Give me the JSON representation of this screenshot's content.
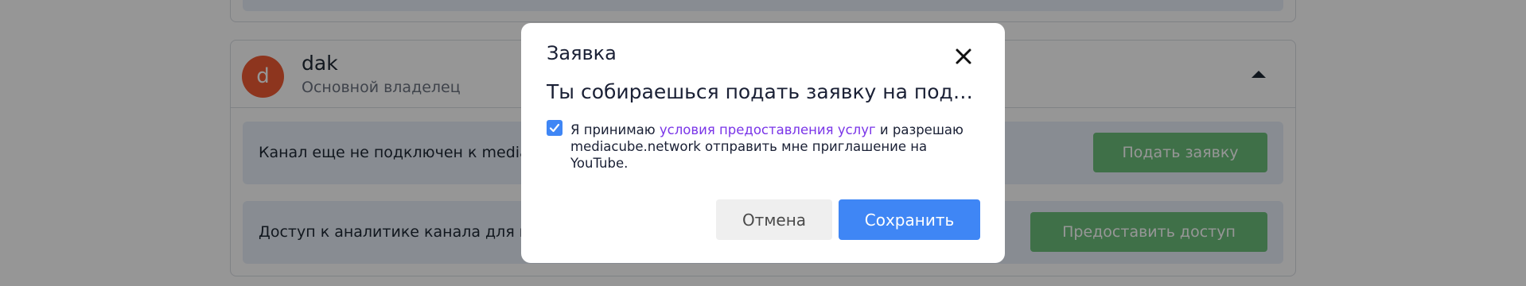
{
  "background": {
    "owner": {
      "avatar_letter": "d",
      "name": "dak",
      "role": "Основной владелец"
    },
    "rows": [
      {
        "text": "Канал еще не подключен к mediacube.network",
        "button": "Подать заявку"
      },
      {
        "text": "Доступ к аналитике канала для mediacube.network",
        "button": "Предоставить доступ"
      }
    ]
  },
  "modal": {
    "title": "Заявка",
    "subtitle": "Ты собираешься подать заявку на подключение канала",
    "consent": {
      "checked": true,
      "text_before": "Я принимаю ",
      "link": "условия предоставления услуг",
      "text_after": " и разрешаю mediacube.network отправить мне приглашение на YouTube."
    },
    "cancel_label": "Отмена",
    "save_label": "Сохранить"
  },
  "colors": {
    "accent": "#3f86f5",
    "link": "#7a35e8",
    "success": "#6cbf7b",
    "avatar": "#f05a33"
  },
  "icons": {
    "close": "close-icon",
    "caret": "caret-up-icon",
    "check": "check-icon"
  }
}
